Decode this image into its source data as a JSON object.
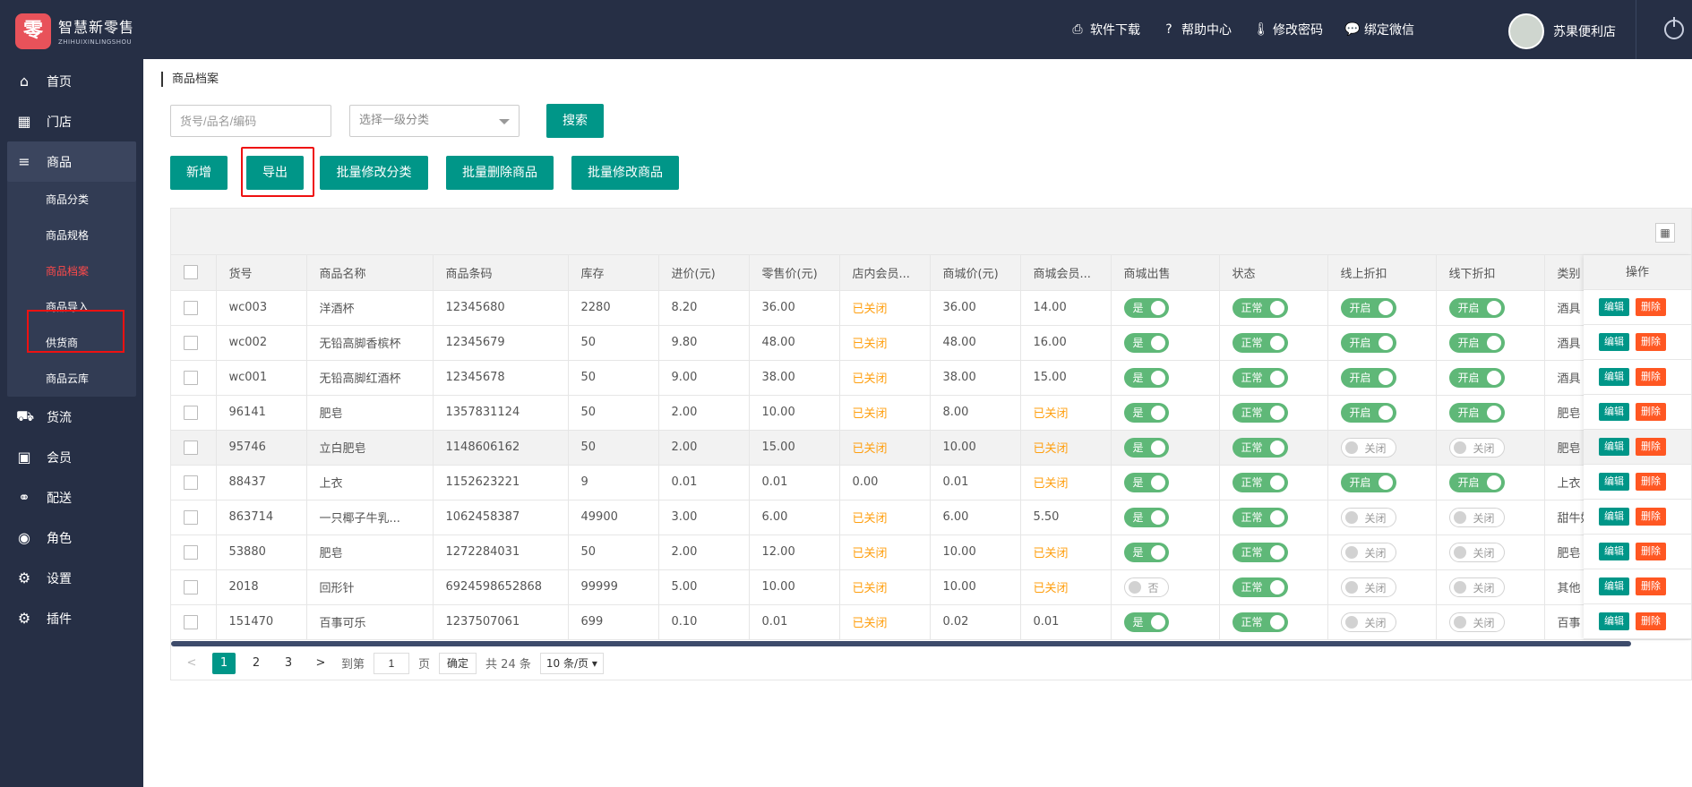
{
  "brand": {
    "logo_char": "零",
    "name": "智慧新零售",
    "sub": "ZHIHUIXINLINGSHOU"
  },
  "topnav": [
    {
      "icon": "printer-icon",
      "label": "软件下载"
    },
    {
      "icon": "question-circle-icon",
      "label": "帮助中心"
    },
    {
      "icon": "thermometer-icon",
      "label": "修改密码"
    },
    {
      "icon": "wechat-icon",
      "label": "绑定微信"
    }
  ],
  "user": {
    "name": "苏果便利店"
  },
  "sidebar": {
    "items": [
      {
        "icon": "home-icon",
        "label": "首页"
      },
      {
        "icon": "building-icon",
        "label": "门店"
      },
      {
        "icon": "bars-icon",
        "label": "商品"
      },
      {
        "icon": "truck-icon",
        "label": "货流"
      },
      {
        "icon": "id-card-icon",
        "label": "会员"
      },
      {
        "icon": "motorcycle-icon",
        "label": "配送"
      },
      {
        "icon": "user-circle-icon",
        "label": "角色"
      },
      {
        "icon": "gear-icon",
        "label": "设置"
      },
      {
        "icon": "gears-icon",
        "label": "插件"
      }
    ],
    "sub_items": [
      "商品分类",
      "商品规格",
      "商品档案",
      "商品导入",
      "供货商",
      "商品云库"
    ],
    "active_sub": "商品档案"
  },
  "breadcrumb": "商品档案",
  "search": {
    "placeholder": "货号/品名/编码",
    "category_placeholder": "选择一级分类",
    "button": "搜索"
  },
  "actions": {
    "add": "新增",
    "export": "导出",
    "batch_category": "批量修改分类",
    "batch_delete": "批量删除商品",
    "batch_edit": "批量修改商品"
  },
  "table": {
    "columns": [
      "货号",
      "商品名称",
      "商品条码",
      "库存",
      "进价(元)",
      "零售价(元)",
      "店内会员...",
      "商城价(元)",
      "商城会员...",
      "商城出售",
      "状态",
      "线上折扣",
      "线下折扣",
      "类别",
      "操作"
    ],
    "rows": [
      {
        "sku": "wc003",
        "name": "洋酒杯",
        "barcode": "12345680",
        "stock": "2280",
        "cost": "8.20",
        "retail": "36.00",
        "member": "已关闭",
        "mall": "36.00",
        "mall_member": "14.00",
        "mall_sale": "是",
        "status": "正常",
        "online": "开启",
        "offline": "开启",
        "category": "酒具"
      },
      {
        "sku": "wc002",
        "name": "无铅高脚香槟杯",
        "barcode": "12345679",
        "stock": "50",
        "cost": "9.80",
        "retail": "48.00",
        "member": "已关闭",
        "mall": "48.00",
        "mall_member": "16.00",
        "mall_sale": "是",
        "status": "正常",
        "online": "开启",
        "offline": "开启",
        "category": "酒具"
      },
      {
        "sku": "wc001",
        "name": "无铅高脚红酒杯",
        "barcode": "12345678",
        "stock": "50",
        "cost": "9.00",
        "retail": "38.00",
        "member": "已关闭",
        "mall": "38.00",
        "mall_member": "15.00",
        "mall_sale": "是",
        "status": "正常",
        "online": "开启",
        "offline": "开启",
        "category": "酒具"
      },
      {
        "sku": "96141",
        "name": "肥皂",
        "barcode": "1357831124",
        "stock": "50",
        "cost": "2.00",
        "retail": "10.00",
        "member": "已关闭",
        "mall": "8.00",
        "mall_member": "已关闭",
        "mall_sale": "是",
        "status": "正常",
        "online": "开启",
        "offline": "开启",
        "category": "肥皂"
      },
      {
        "sku": "95746",
        "name": "立白肥皂",
        "barcode": "1148606162",
        "stock": "50",
        "cost": "2.00",
        "retail": "15.00",
        "member": "已关闭",
        "mall": "10.00",
        "mall_member": "已关闭",
        "mall_sale": "是",
        "status": "正常",
        "online": "关闭",
        "offline": "关闭",
        "category": "肥皂"
      },
      {
        "sku": "88437",
        "name": "上衣",
        "barcode": "1152623221",
        "stock": "9",
        "cost": "0.01",
        "retail": "0.01",
        "member": "0.00",
        "mall": "0.01",
        "mall_member": "已关闭",
        "mall_sale": "是",
        "status": "正常",
        "online": "开启",
        "offline": "开启",
        "category": "上衣"
      },
      {
        "sku": "863714",
        "name": "一只椰子牛乳...",
        "barcode": "1062458387",
        "stock": "49900",
        "cost": "3.00",
        "retail": "6.00",
        "member": "已关闭",
        "mall": "6.00",
        "mall_member": "5.50",
        "mall_sale": "是",
        "status": "正常",
        "online": "关闭",
        "offline": "关闭",
        "category": "甜牛奶"
      },
      {
        "sku": "53880",
        "name": "肥皂",
        "barcode": "1272284031",
        "stock": "50",
        "cost": "2.00",
        "retail": "12.00",
        "member": "已关闭",
        "mall": "10.00",
        "mall_member": "已关闭",
        "mall_sale": "是",
        "status": "正常",
        "online": "关闭",
        "offline": "关闭",
        "category": "肥皂"
      },
      {
        "sku": "2018",
        "name": "回形针",
        "barcode": "6924598652868",
        "stock": "99999",
        "cost": "5.00",
        "retail": "10.00",
        "member": "已关闭",
        "mall": "10.00",
        "mall_member": "已关闭",
        "mall_sale": "否",
        "status": "正常",
        "online": "关闭",
        "offline": "关闭",
        "category": "其他"
      },
      {
        "sku": "151470",
        "name": "百事可乐",
        "barcode": "1237507061",
        "stock": "699",
        "cost": "0.10",
        "retail": "0.01",
        "member": "已关闭",
        "mall": "0.02",
        "mall_member": "0.01",
        "mall_sale": "是",
        "status": "正常",
        "online": "关闭",
        "offline": "关闭",
        "category": "百事"
      }
    ],
    "edit_label": "编辑",
    "delete_label": "删除",
    "shaded_row": 4
  },
  "pager": {
    "pages": [
      "1",
      "2",
      "3"
    ],
    "current": "1",
    "goto_label": "到第",
    "goto_value": "1",
    "page_label": "页",
    "confirm": "确定",
    "total": "共 24 条",
    "page_size": "10 条/页"
  },
  "colors": {
    "primary": "#009688",
    "sidebar": "#262f45",
    "switch_on": "#5fb878",
    "warning": "#ff9f0f",
    "danger": "#ff5722",
    "highlight": "#ee1111"
  }
}
